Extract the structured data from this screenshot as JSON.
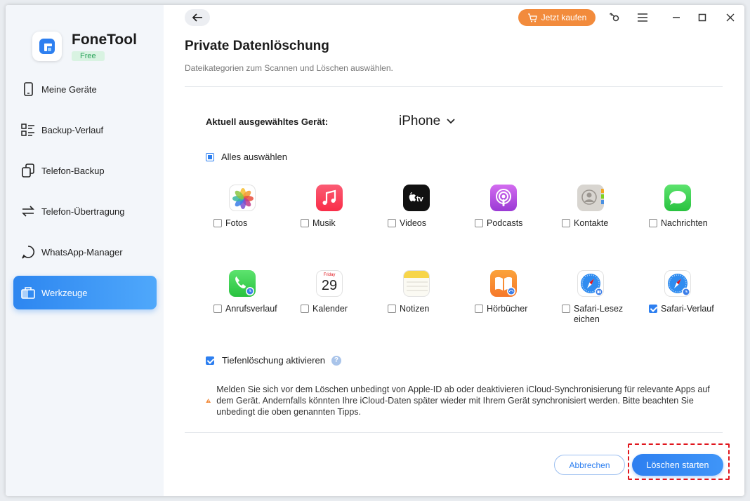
{
  "app": {
    "name": "FoneTool",
    "badge": "Free"
  },
  "sidebar": {
    "items": [
      {
        "label": "Meine Geräte",
        "icon": "phone-icon",
        "active": false
      },
      {
        "label": "Backup-Verlauf",
        "icon": "list-icon",
        "active": false
      },
      {
        "label": "Telefon-Backup",
        "icon": "copy-icon",
        "active": false
      },
      {
        "label": "Telefon-Übertragung",
        "icon": "transfer-icon",
        "active": false
      },
      {
        "label": "WhatsApp-Manager",
        "icon": "chat-bubble-icon",
        "active": false
      },
      {
        "label": "Werkzeuge",
        "icon": "toolbox-icon",
        "active": true
      }
    ]
  },
  "topbar": {
    "buy_label": "Jetzt kaufen"
  },
  "page": {
    "title": "Private Datenlöschung",
    "subtitle": "Dateikategorien zum Scannen und Löschen auswählen.",
    "device_label": "Aktuell ausgewähltes Gerät:",
    "device_value": "iPhone",
    "select_all_label": "Alles auswählen",
    "select_all_state": "partial",
    "categories": [
      {
        "label": "Fotos",
        "icon": "photos-icon",
        "checked": false
      },
      {
        "label": "Musik",
        "icon": "music-icon",
        "checked": false
      },
      {
        "label": "Videos",
        "icon": "appletv-icon",
        "checked": false
      },
      {
        "label": "Podcasts",
        "icon": "podcasts-icon",
        "checked": false
      },
      {
        "label": "Kontakte",
        "icon": "contacts-icon",
        "checked": false
      },
      {
        "label": "Nachrichten",
        "icon": "messages-icon",
        "checked": false
      },
      {
        "label": "Anrufsverlauf",
        "icon": "phone-call-icon",
        "checked": false
      },
      {
        "label": "Kalender",
        "icon": "calendar-icon",
        "checked": false,
        "day_label": "Friday",
        "day_number": "29"
      },
      {
        "label": "Notizen",
        "icon": "notes-icon",
        "checked": false
      },
      {
        "label": "Hörbücher",
        "icon": "audiobooks-icon",
        "checked": false
      },
      {
        "label": "Safari-Lesezeichen",
        "icon": "safari-bookmarks-icon",
        "checked": false
      },
      {
        "label": "Safari-Verlauf",
        "icon": "safari-history-icon",
        "checked": true
      }
    ],
    "deep_erase_label": "Tiefenlöschung aktivieren",
    "deep_erase_checked": true,
    "help_glyph": "?",
    "warning_text": "Melden Sie sich vor dem Löschen unbedingt von Apple-ID ab oder deaktivieren iCloud-Synchronisierung für relevante Apps auf dem Gerät. Andernfalls könnten Ihre iCloud-Daten später wieder mit Ihrem Gerät synchronisiert werden. Bitte beachten Sie unbedingt die oben genannten Tipps.",
    "cancel_label": "Abbrechen",
    "start_label": "Löschen starten"
  },
  "colors": {
    "accent": "#2d7ff0",
    "buy": "#f28b3c",
    "highlight": "#e0161d",
    "warning": "#f28b3c"
  }
}
